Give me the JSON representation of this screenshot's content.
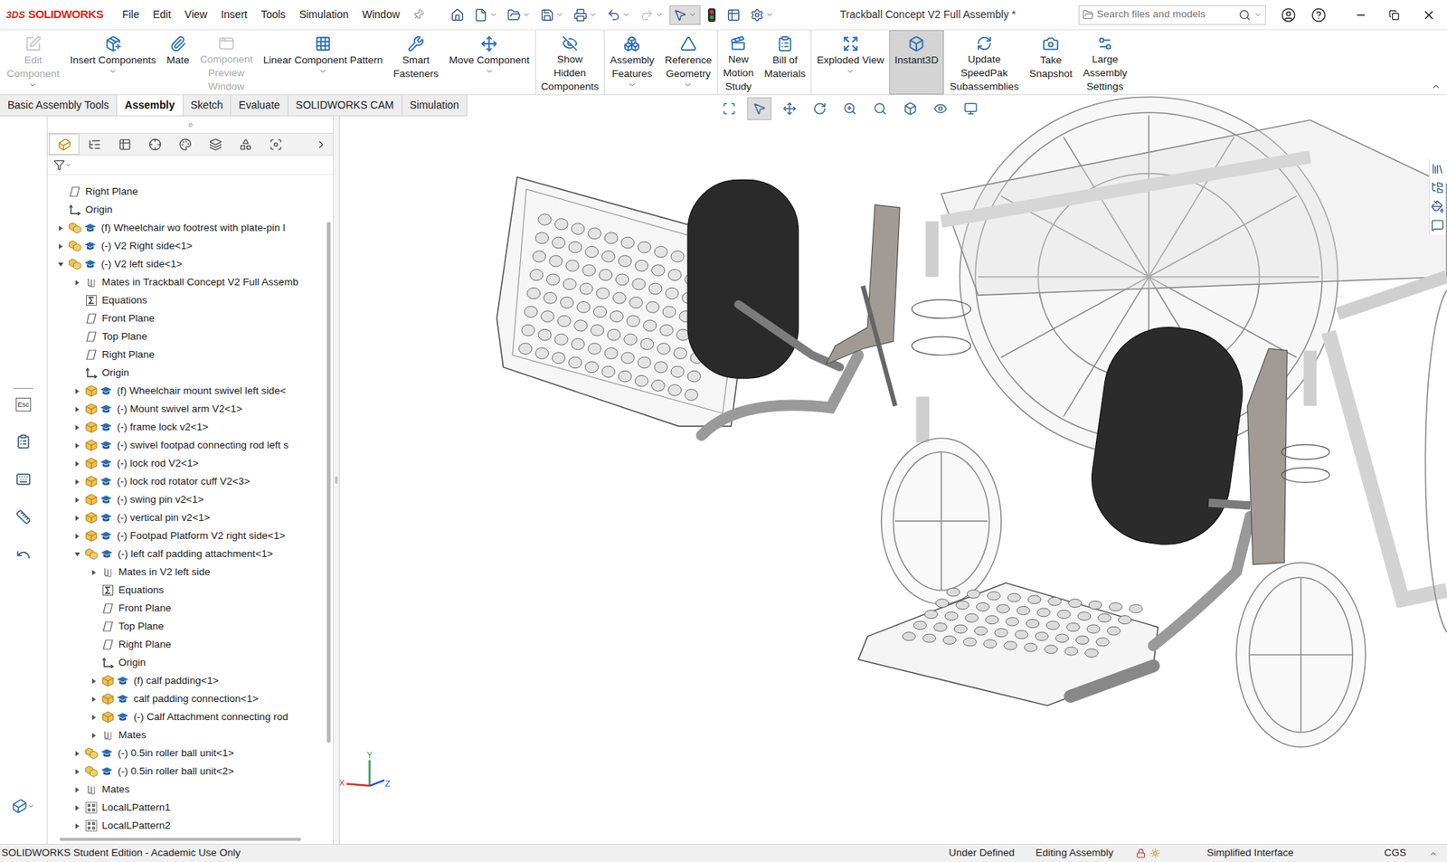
{
  "window": {
    "logo_mark": "3DS",
    "logo": "SOLIDWORKS",
    "title": "Trackball Concept V2 Full Assembly *"
  },
  "menus": [
    "File",
    "Edit",
    "View",
    "Insert",
    "Tools",
    "Simulation",
    "Window"
  ],
  "quick_access": [
    {
      "disabled": false,
      "selected": false,
      "dropdown": false
    },
    {
      "disabled": false,
      "selected": false,
      "dropdown": true
    },
    {
      "disabled": false,
      "selected": false,
      "dropdown": true
    },
    {
      "disabled": false,
      "selected": false,
      "dropdown": true
    },
    {
      "disabled": false,
      "selected": false,
      "dropdown": true
    },
    {
      "disabled": false,
      "selected": false,
      "dropdown": true
    },
    {
      "disabled": true,
      "selected": false,
      "dropdown": true
    },
    {
      "disabled": false,
      "selected": true,
      "dropdown": true
    },
    {
      "disabled": false,
      "selected": false,
      "dropdown": false
    },
    {
      "disabled": false,
      "selected": false,
      "dropdown": false
    },
    {
      "disabled": false,
      "selected": false,
      "dropdown": true
    }
  ],
  "search": {
    "placeholder": "Search files and models"
  },
  "ribbon_groups": [
    [
      {
        "lines": [
          "Edit",
          "Component"
        ],
        "disabled": true,
        "dropdown": true,
        "selected": false
      },
      {
        "lines": [
          "Insert Components"
        ],
        "disabled": false,
        "dropdown": true,
        "selected": false
      },
      {
        "lines": [
          "Mate"
        ],
        "disabled": false,
        "dropdown": false,
        "selected": false
      },
      {
        "lines": [
          "Component",
          "Preview",
          "Window"
        ],
        "disabled": true,
        "dropdown": false,
        "selected": false
      },
      {
        "lines": [
          "Linear Component Pattern"
        ],
        "disabled": false,
        "dropdown": true,
        "selected": false
      },
      {
        "lines": [
          "Smart",
          "Fasteners"
        ],
        "disabled": false,
        "dropdown": false,
        "selected": false
      },
      {
        "lines": [
          "Move Component"
        ],
        "disabled": false,
        "dropdown": true,
        "selected": false
      }
    ],
    [
      {
        "lines": [
          "Show",
          "Hidden",
          "Components"
        ],
        "disabled": false,
        "dropdown": false,
        "selected": false
      }
    ],
    [
      {
        "lines": [
          "Assembly",
          "Features"
        ],
        "disabled": false,
        "dropdown": true,
        "selected": false
      },
      {
        "lines": [
          "Reference",
          "Geometry"
        ],
        "disabled": false,
        "dropdown": true,
        "selected": false
      }
    ],
    [
      {
        "lines": [
          "New",
          "Motion",
          "Study"
        ],
        "disabled": false,
        "dropdown": false,
        "selected": false
      },
      {
        "lines": [
          "Bill of",
          "Materials"
        ],
        "disabled": false,
        "dropdown": false,
        "selected": false
      }
    ],
    [
      {
        "lines": [
          "Exploded View"
        ],
        "disabled": false,
        "dropdown": true,
        "selected": false
      },
      {
        "lines": [
          "Instant3D"
        ],
        "disabled": false,
        "dropdown": false,
        "selected": true
      }
    ],
    [
      {
        "lines": [
          "Update",
          "SpeedPak",
          "Subassemblies"
        ],
        "disabled": false,
        "dropdown": false,
        "selected": false
      },
      {
        "lines": [
          "Take",
          "Snapshot"
        ],
        "disabled": false,
        "dropdown": false,
        "selected": false
      },
      {
        "lines": [
          "Large",
          "Assembly",
          "Settings"
        ],
        "disabled": false,
        "dropdown": false,
        "selected": false
      }
    ]
  ],
  "command_tabs": [
    {
      "label": "Basic Assembly Tools",
      "selected": false
    },
    {
      "label": "Assembly",
      "selected": true
    },
    {
      "label": "Sketch",
      "selected": false
    },
    {
      "label": "Evaluate",
      "selected": false
    },
    {
      "label": "SOLIDWORKS CAM",
      "selected": false
    },
    {
      "label": "Simulation",
      "selected": false
    }
  ],
  "panel_tabs": [
    {
      "selected": true
    },
    {
      "selected": false
    },
    {
      "selected": false
    },
    {
      "selected": false
    },
    {
      "selected": false
    },
    {
      "selected": false
    },
    {
      "selected": false
    },
    {
      "selected": false
    }
  ],
  "left_strip": {
    "esc_label": "Esc"
  },
  "tree": [
    {
      "label": "Right Plane",
      "depth": 0,
      "kind": "plane",
      "expandable": false,
      "expanded": false
    },
    {
      "label": "Origin",
      "depth": 0,
      "kind": "origin",
      "expandable": false,
      "expanded": false
    },
    {
      "label": "(f) Wheelchair wo footrest with plate-pin l",
      "depth": 0,
      "kind": "assembly",
      "expandable": true,
      "expanded": false
    },
    {
      "label": "(-) V2 Right side<1>",
      "depth": 0,
      "kind": "assembly",
      "expandable": true,
      "expanded": false
    },
    {
      "label": "(-) V2 left side<1>",
      "depth": 0,
      "kind": "assembly",
      "expandable": true,
      "expanded": true
    },
    {
      "label": "Mates in Trackball Concept V2 Full Assemb",
      "depth": 1,
      "kind": "mates",
      "expandable": true,
      "expanded": false
    },
    {
      "label": "Equations",
      "depth": 1,
      "kind": "equations",
      "expandable": false,
      "expanded": false
    },
    {
      "label": "Front Plane",
      "depth": 1,
      "kind": "plane",
      "expandable": false,
      "expanded": false
    },
    {
      "label": "Top Plane",
      "depth": 1,
      "kind": "plane",
      "expandable": false,
      "expanded": false
    },
    {
      "label": "Right Plane",
      "depth": 1,
      "kind": "plane",
      "expandable": false,
      "expanded": false
    },
    {
      "label": "Origin",
      "depth": 1,
      "kind": "origin",
      "expandable": false,
      "expanded": false
    },
    {
      "label": "(f) Wheelchair mount swivel left side<",
      "depth": 1,
      "kind": "part",
      "expandable": true,
      "expanded": false
    },
    {
      "label": "(-) Mount swivel arm V2<1>",
      "depth": 1,
      "kind": "part",
      "expandable": true,
      "expanded": false
    },
    {
      "label": "(-) frame lock v2<1>",
      "depth": 1,
      "kind": "part",
      "expandable": true,
      "expanded": false
    },
    {
      "label": "(-) swivel footpad connecting rod left s",
      "depth": 1,
      "kind": "part",
      "expandable": true,
      "expanded": false
    },
    {
      "label": "(-) lock rod V2<1>",
      "depth": 1,
      "kind": "part",
      "expandable": true,
      "expanded": false
    },
    {
      "label": "(-) lock rod rotator cuff V2<3>",
      "depth": 1,
      "kind": "part",
      "expandable": true,
      "expanded": false
    },
    {
      "label": "(-) swing pin v2<1>",
      "depth": 1,
      "kind": "part",
      "expandable": true,
      "expanded": false
    },
    {
      "label": "(-) vertical pin v2<1>",
      "depth": 1,
      "kind": "part",
      "expandable": true,
      "expanded": false
    },
    {
      "label": "(-) Footpad Platform V2 right side<1>",
      "depth": 1,
      "kind": "part",
      "expandable": true,
      "expanded": false
    },
    {
      "label": "(-) left calf padding attachment<1>",
      "depth": 1,
      "kind": "assembly",
      "expandable": true,
      "expanded": true
    },
    {
      "label": "Mates in V2 left side",
      "depth": 2,
      "kind": "mates",
      "expandable": true,
      "expanded": false
    },
    {
      "label": "Equations",
      "depth": 2,
      "kind": "equations",
      "expandable": false,
      "expanded": false
    },
    {
      "label": "Front Plane",
      "depth": 2,
      "kind": "plane",
      "expandable": false,
      "expanded": false
    },
    {
      "label": "Top Plane",
      "depth": 2,
      "kind": "plane",
      "expandable": false,
      "expanded": false
    },
    {
      "label": "Right Plane",
      "depth": 2,
      "kind": "plane",
      "expandable": false,
      "expanded": false
    },
    {
      "label": "Origin",
      "depth": 2,
      "kind": "origin",
      "expandable": false,
      "expanded": false
    },
    {
      "label": "(f) calf padding<1>",
      "depth": 2,
      "kind": "part",
      "expandable": true,
      "expanded": false
    },
    {
      "label": "calf padding connection<1>",
      "depth": 2,
      "kind": "part",
      "expandable": true,
      "expanded": false
    },
    {
      "label": "(-) Calf Attachment connecting rod",
      "depth": 2,
      "kind": "part",
      "expandable": true,
      "expanded": false
    },
    {
      "label": "Mates",
      "depth": 2,
      "kind": "mates",
      "expandable": true,
      "expanded": false
    },
    {
      "label": "(-) 0.5in roller ball unit<1>",
      "depth": 1,
      "kind": "assembly",
      "expandable": true,
      "expanded": false
    },
    {
      "label": "(-) 0.5in roller ball unit<2>",
      "depth": 1,
      "kind": "assembly",
      "expandable": true,
      "expanded": false
    },
    {
      "label": "Mates",
      "depth": 1,
      "kind": "mates",
      "expandable": true,
      "expanded": false
    },
    {
      "label": "LocalLPattern1",
      "depth": 1,
      "kind": "pattern",
      "expandable": true,
      "expanded": false
    },
    {
      "label": "LocalLPattern2",
      "depth": 1,
      "kind": "pattern",
      "expandable": true,
      "expanded": false
    }
  ],
  "heads_up_tools": [
    {
      "selected": false
    },
    {
      "selected": true
    },
    {
      "selected": false
    },
    {
      "selected": false
    },
    {
      "selected": false
    },
    {
      "selected": false
    },
    {
      "selected": false
    },
    {
      "selected": false
    },
    {
      "selected": false
    }
  ],
  "triad": [
    "X",
    "Y",
    "Z"
  ],
  "status_bar": {
    "left": "SOLIDWORKS Student Edition - Academic Use Only",
    "state": "Under Defined",
    "mode": "Editing Assembly",
    "interface": "Simplified Interface",
    "units": "CGS"
  }
}
